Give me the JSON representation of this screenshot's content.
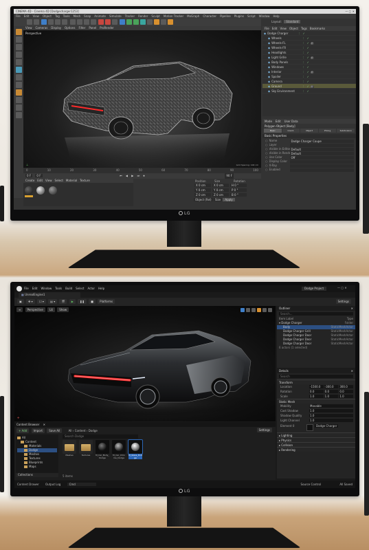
{
  "c4d": {
    "title": "CINEMA 4D - Cinema 4D [Dodgecharger1253]",
    "menus": [
      "File",
      "Edit",
      "View",
      "Object",
      "Tag",
      "Tools",
      "Mesh",
      "Snap",
      "Animate",
      "Simulate",
      "Tracker",
      "Render",
      "Sculpt",
      "Motion Tracker",
      "MoGraph",
      "Character",
      "Pipeline",
      "Plugins",
      "Script",
      "Window",
      "Help"
    ],
    "layout_label": "Layout:",
    "layout_value": "Standard",
    "viewport_menus": [
      "View",
      "Cameras",
      "Display",
      "Options",
      "Filter",
      "Panel",
      "ProRender"
    ],
    "viewport_name": "Perspective",
    "viewport_footer": "Grid Spacing: 100 cm",
    "obj_tabs": [
      "File",
      "Edit",
      "View",
      "Object",
      "Tags",
      "Bookmarks"
    ],
    "objects": [
      {
        "name": "Dodge Charger",
        "sel": false
      },
      {
        "name": "Wheels",
        "sel": false
      },
      {
        "name": "Wheels-FL",
        "sel": false
      },
      {
        "name": "Wheels-FR",
        "sel": false
      },
      {
        "name": "Headlights",
        "sel": false
      },
      {
        "name": "Light Grille",
        "sel": false
      },
      {
        "name": "Body Panels",
        "sel": false
      },
      {
        "name": "Windows",
        "sel": false
      },
      {
        "name": "Interior",
        "sel": false
      },
      {
        "name": "Spoiler",
        "sel": false
      },
      {
        "name": "Camera",
        "sel": false
      },
      {
        "name": "Ground",
        "sel": true
      },
      {
        "name": "Sky Environment",
        "sel": false
      }
    ],
    "attr_tabs": [
      "Mode",
      "Edit",
      "User Data"
    ],
    "attr_title": "Polygon Object [Body]",
    "attr_subtabs": [
      "Basic",
      "Coord.",
      "Object",
      "Phong",
      "Subdivision"
    ],
    "attr_section": "Basic Properties",
    "attr_rows": [
      {
        "label": "Name",
        "value": "Dodge Charger Coupe"
      },
      {
        "label": "Layer",
        "value": ""
      },
      {
        "label": "Visible in Editor",
        "value": "Default"
      },
      {
        "label": "Visible in Renderer",
        "value": "Default"
      },
      {
        "label": "Use Color",
        "value": "Off"
      },
      {
        "label": "Display Color",
        "value": ""
      },
      {
        "label": "X-Ray",
        "value": ""
      },
      {
        "label": "Enabled",
        "value": ""
      }
    ],
    "timeline_ticks": [
      "0",
      "10",
      "20",
      "30",
      "40",
      "50",
      "60",
      "70",
      "80",
      "90",
      "100"
    ],
    "frame_start": "0 F",
    "frame_end": "90 F",
    "frame_current": "0 F",
    "mat_menus": [
      "Create",
      "Edit",
      "View",
      "Select",
      "Material",
      "Texture"
    ],
    "coord_headers": [
      "Position",
      "Size",
      "Rotation"
    ],
    "coord_rows": [
      [
        "X  0 cm",
        "X  0 cm",
        "H  0 °"
      ],
      [
        "Y  0 cm",
        "Y  0 cm",
        "P  0 °"
      ],
      [
        "Z  0 cm",
        "Z  0 cm",
        "B  0 °"
      ]
    ],
    "coord_mode": "Object (Rel)",
    "coord_size": "Size",
    "apply_label": "Apply"
  },
  "ue": {
    "tab_title": "UnrealEngine1",
    "menus": [
      "File",
      "Edit",
      "Window",
      "Tools",
      "Build",
      "Select",
      "Actor",
      "Help"
    ],
    "project": "Dodge Project",
    "platforms": "Platforms",
    "settings": "Settings",
    "vp_perspective": "Perspective",
    "vp_lit": "Lit",
    "vp_show": "Show",
    "outliner_title": "Outliner",
    "outliner_search": "Search...",
    "outliner_cols": [
      "Item Label",
      "Type"
    ],
    "outliner_items": [
      {
        "label": "Dodge Charger",
        "type": "Folder"
      },
      {
        "label": "Body",
        "type": "StaticMeshActor"
      },
      {
        "label": "Dodge Charger Grill",
        "type": "StaticMeshActor"
      },
      {
        "label": "Dodge Charger Door",
        "type": "StaticMeshActor"
      },
      {
        "label": "Dodge Charger Door",
        "type": "StaticMeshActor"
      },
      {
        "label": "Dodge Charger Door",
        "type": "StaticMeshActor"
      }
    ],
    "outliner_status": "6 actors (1 selected)",
    "details_title": "Details",
    "details_search": "Search",
    "det_transform": "Transform",
    "det_rows": [
      {
        "label": "Location",
        "v": [
          "-1500.0",
          "-300.0",
          "300.0"
        ]
      },
      {
        "label": "Rotation",
        "v": [
          "0.0",
          "0.0",
          "0.0"
        ]
      },
      {
        "label": "Scale",
        "v": [
          "1.0",
          "1.0",
          "1.0"
        ]
      }
    ],
    "det_static": "Static Mesh",
    "det_mesh_rows": [
      {
        "label": "Mobility",
        "value": "Movable"
      },
      {
        "label": "Cast Shadow",
        "value": "1.0"
      },
      {
        "label": "Shadow Quality",
        "value": "1.0"
      },
      {
        "label": "Light Channel",
        "value": "1.0"
      }
    ],
    "det_material_label": "Element 0",
    "det_material_value": "Dodge Charger",
    "det_sections": [
      "Lighting",
      "Physics",
      "Collision",
      "Rendering"
    ],
    "cb_title": "Content Browser",
    "cb_add": "+ Add",
    "cb_import": "Import",
    "cb_save": "Save All",
    "cb_settings": "Settings",
    "cb_path": [
      "All",
      "Content",
      "Dodge"
    ],
    "cb_search": "Search Dodge",
    "cb_tree": [
      {
        "label": "All",
        "indent": 0,
        "sel": false
      },
      {
        "label": "Content",
        "indent": 1,
        "sel": false
      },
      {
        "label": "Materials",
        "indent": 2,
        "sel": false
      },
      {
        "label": "Dodge",
        "indent": 2,
        "sel": true
      },
      {
        "label": "Meshes",
        "indent": 2,
        "sel": false
      },
      {
        "label": "Textures",
        "indent": 2,
        "sel": false
      },
      {
        "label": "Blueprints",
        "indent": 2,
        "sel": false
      },
      {
        "label": "Maps",
        "indent": 2,
        "sel": false
      }
    ],
    "cb_collections": "Collections",
    "cb_assets": [
      {
        "label": "Meshes",
        "kind": "folder"
      },
      {
        "label": "Textures",
        "kind": "folder"
      },
      {
        "label": "M_Car_Body_Dodge",
        "kind": "mat-dark"
      },
      {
        "label": "M_Car_Chrome_Dodge",
        "kind": "mat-red"
      },
      {
        "label": "M_Glass_Dodge",
        "kind": "mat-white"
      }
    ],
    "cb_count": "5 items",
    "status_left": "Content Drawer",
    "status_mid": "Output Log",
    "status_cmd": "Cmd",
    "status_right": "Source Control",
    "status_saved": "All Saved"
  },
  "colors": {
    "c4d_panel": "#333333",
    "ue_panel": "#1e1e1e",
    "ue_accent": "#2c67b8",
    "car_light": "#ff2a2a"
  }
}
